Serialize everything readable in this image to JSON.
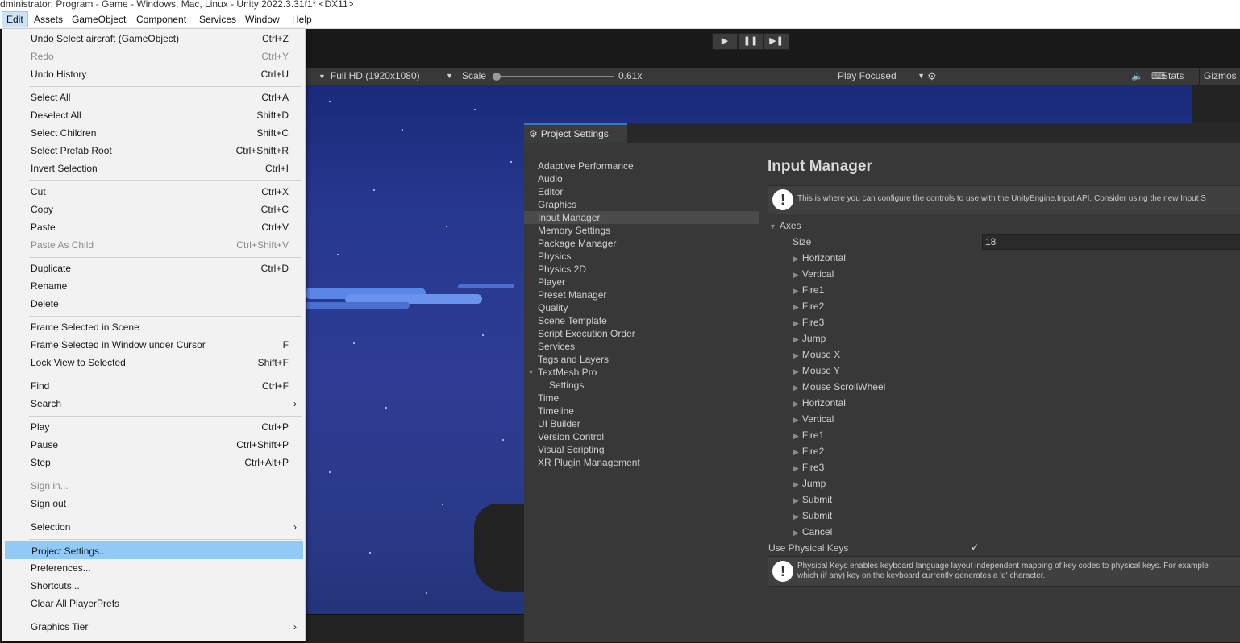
{
  "title_bar": "dministrator: Program - Game - Windows, Mac, Linux - Unity 2022.3.31f1* <DX11>",
  "menu_bar": [
    "Edit",
    "Assets",
    "GameObject",
    "Component",
    "Services",
    "Window",
    "Help"
  ],
  "edit_menu": [
    {
      "label": "Undo Select aircraft (GameObject)",
      "shortcut": "Ctrl+Z"
    },
    {
      "label": "Redo",
      "shortcut": "Ctrl+Y"
    },
    {
      "label": "Undo History",
      "shortcut": "Ctrl+U"
    },
    {
      "label": "Select All",
      "shortcut": "Ctrl+A"
    },
    {
      "label": "Deselect All",
      "shortcut": "Shift+D"
    },
    {
      "label": "Select Children",
      "shortcut": "Shift+C"
    },
    {
      "label": "Select Prefab Root",
      "shortcut": "Ctrl+Shift+R"
    },
    {
      "label": "Invert Selection",
      "shortcut": "Ctrl+I"
    },
    {
      "label": "Cut",
      "shortcut": "Ctrl+X"
    },
    {
      "label": "Copy",
      "shortcut": "Ctrl+C"
    },
    {
      "label": "Paste",
      "shortcut": "Ctrl+V"
    },
    {
      "label": "Paste As Child",
      "shortcut": "Ctrl+Shift+V"
    },
    {
      "label": "Duplicate",
      "shortcut": "Ctrl+D"
    },
    {
      "label": "Rename",
      "shortcut": ""
    },
    {
      "label": "Delete",
      "shortcut": ""
    },
    {
      "label": "Frame Selected in Scene",
      "shortcut": ""
    },
    {
      "label": "Frame Selected in Window under Cursor",
      "shortcut": "F"
    },
    {
      "label": "Lock View to Selected",
      "shortcut": "Shift+F"
    },
    {
      "label": "Find",
      "shortcut": "Ctrl+F"
    },
    {
      "label": "Search",
      "shortcut": ""
    },
    {
      "label": "Play",
      "shortcut": "Ctrl+P"
    },
    {
      "label": "Pause",
      "shortcut": "Ctrl+Shift+P"
    },
    {
      "label": "Step",
      "shortcut": "Ctrl+Alt+P"
    },
    {
      "label": "Sign in...",
      "shortcut": ""
    },
    {
      "label": "Sign out",
      "shortcut": ""
    },
    {
      "label": "Selection",
      "shortcut": ""
    },
    {
      "label": "Project Settings...",
      "shortcut": ""
    },
    {
      "label": "Preferences...",
      "shortcut": ""
    },
    {
      "label": "Shortcuts...",
      "shortcut": ""
    },
    {
      "label": "Clear All PlayerPrefs",
      "shortcut": ""
    },
    {
      "label": "Graphics Tier",
      "shortcut": ""
    }
  ],
  "game_bar": {
    "resolution": "Full HD (1920x1080)",
    "scale_label": "Scale",
    "scale_value": "0.61x",
    "play_mode": "Play Focused",
    "stats": "Stats",
    "gizmos": "Gizmos"
  },
  "project_settings": {
    "tab_title": "Project Settings",
    "sidebar": [
      "Adaptive Performance",
      "Audio",
      "Editor",
      "Graphics",
      "Input Manager",
      "Memory Settings",
      "Package Manager",
      "Physics",
      "Physics 2D",
      "Player",
      "Preset Manager",
      "Quality",
      "Scene Template",
      "Script Execution Order",
      "Services",
      "Tags and Layers",
      "TextMesh Pro",
      "Settings",
      "Time",
      "Timeline",
      "UI Builder",
      "Version Control",
      "Visual Scripting",
      "XR Plugin Management"
    ],
    "selected": "Input Manager",
    "heading": "Input Manager",
    "info_text": "This is where you can configure the controls to use with the UnityEngine.Input API. Consider using the new Input S",
    "axes_label": "Axes",
    "size_label": "Size",
    "size_value": "18",
    "axes": [
      "Horizontal",
      "Vertical",
      "Fire1",
      "Fire2",
      "Fire3",
      "Jump",
      "Mouse X",
      "Mouse Y",
      "Mouse ScrollWheel",
      "Horizontal",
      "Vertical",
      "Fire1",
      "Fire2",
      "Fire3",
      "Jump",
      "Submit",
      "Submit",
      "Cancel"
    ],
    "physical_keys_label": "Use Physical Keys",
    "physical_keys_checked": true,
    "physical_info_line1": "Physical Keys enables keyboard language layout independent mapping of key codes to physical keys. For example",
    "physical_info_line2": "which (if any) key on the keyboard currently generates a 'q' character."
  }
}
